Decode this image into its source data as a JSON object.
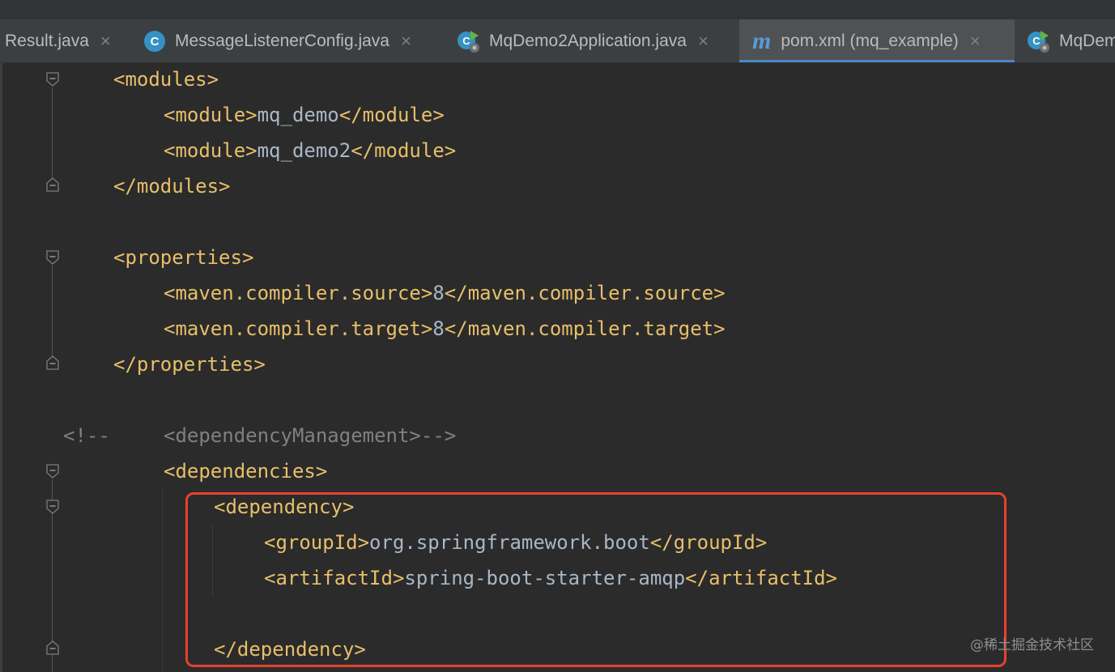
{
  "tabs": [
    {
      "label": "Result.java",
      "icon": "none",
      "active": false
    },
    {
      "label": "MessageListenerConfig.java",
      "icon": "class-icon",
      "active": false
    },
    {
      "label": "MqDemo2Application.java",
      "icon": "spring-app-icon",
      "active": false
    },
    {
      "label": "pom.xml (mq_example)",
      "icon": "maven-icon",
      "active": true
    },
    {
      "label": "MqDem",
      "icon": "spring-app-icon",
      "active": false
    }
  ],
  "class_icon_letter": "C",
  "maven_icon_letter": "m",
  "tab_close_glyph": "×",
  "code": {
    "l1": "<modules>",
    "l2_open": "<module>",
    "l2_val": "mq_demo",
    "l2_close": "</module>",
    "l3_open": "<module>",
    "l3_val": "mq_demo2",
    "l3_close": "</module>",
    "l4": "</modules>",
    "l6": "<properties>",
    "l7_open": "<maven.compiler.source>",
    "l7_val": "8",
    "l7_close": "</maven.compiler.source>",
    "l8_open": "<maven.compiler.target>",
    "l8_val": "8",
    "l8_close": "</maven.compiler.target>",
    "l9": "</properties>",
    "l11_comment_start": "<!--",
    "l11_comment_body": "<dependencyManagement>-->",
    "l12": "<dependencies>",
    "l13": "<dependency>",
    "l14_open": "<groupId>",
    "l14_val": "org.springframework.boot",
    "l14_close": "</groupId>",
    "l15_open": "<artifactId>",
    "l15_val": "spring-boot-starter-amqp",
    "l15_close": "</artifactId>",
    "l17": "</dependency>"
  },
  "watermark": "@稀土掘金技术社区",
  "colors": {
    "background": "#2b2b2b",
    "tag": "#e8bf6a",
    "text": "#a9b7c6",
    "comment": "#808080",
    "tab_active_underline": "#4a88c7",
    "highlight_box": "#e8402f"
  }
}
